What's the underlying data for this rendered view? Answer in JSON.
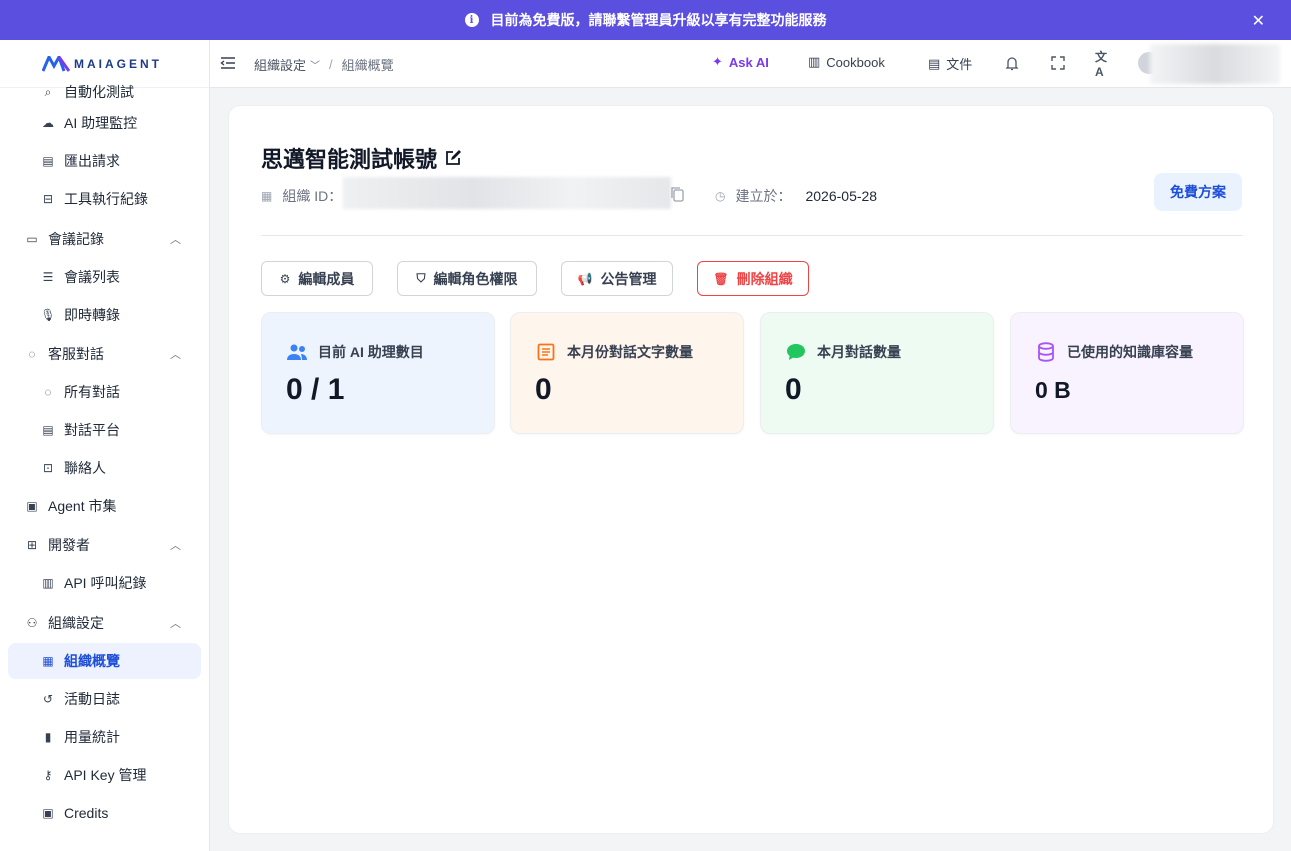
{
  "banner": {
    "text": "目前為免費版，請聯繫管理員升級以享有完整功能服務",
    "close_icon": "close-icon"
  },
  "logo": {
    "word": "MAIAGENT"
  },
  "sidebar": {
    "items": [
      {
        "label": "自動化測試",
        "icon": "search-icon",
        "kind": "sub"
      },
      {
        "label": "AI 助理監控",
        "icon": "cloud-icon",
        "kind": "sub"
      },
      {
        "label": "匯出請求",
        "icon": "file-export-icon",
        "kind": "sub"
      },
      {
        "label": "工具執行紀錄",
        "icon": "toolbox-icon",
        "kind": "sub"
      },
      {
        "label": "會議記錄",
        "icon": "presentation-icon",
        "kind": "group"
      },
      {
        "label": "會議列表",
        "icon": "list-icon",
        "kind": "sub"
      },
      {
        "label": "即時轉錄",
        "icon": "microphone-icon",
        "kind": "sub"
      },
      {
        "label": "客服對話",
        "icon": "chat-icon",
        "kind": "group"
      },
      {
        "label": "所有對話",
        "icon": "chat-dots-icon",
        "kind": "sub"
      },
      {
        "label": "對話平台",
        "icon": "platform-icon",
        "kind": "sub"
      },
      {
        "label": "聯絡人",
        "icon": "contact-card-icon",
        "kind": "sub"
      },
      {
        "label": "Agent 市集",
        "icon": "market-chat-icon",
        "kind": "single"
      },
      {
        "label": "開發者",
        "icon": "developer-icon",
        "kind": "group"
      },
      {
        "label": "API 呼叫紀錄",
        "icon": "document-icon",
        "kind": "sub"
      },
      {
        "label": "組織設定",
        "icon": "team-icon",
        "kind": "group"
      },
      {
        "label": "組織概覽",
        "icon": "grid-icon",
        "kind": "sub"
      },
      {
        "label": "活動日誌",
        "icon": "history-icon",
        "kind": "sub"
      },
      {
        "label": "用量統計",
        "icon": "bar-chart-icon",
        "kind": "sub"
      },
      {
        "label": "API Key 管理",
        "icon": "key-icon",
        "kind": "sub"
      },
      {
        "label": "Credits",
        "icon": "wallet-icon",
        "kind": "sub"
      }
    ],
    "active": "組織概覽"
  },
  "header": {
    "breadcrumb_parent": "組織設定",
    "breadcrumb_sep": "/",
    "breadcrumb_current": "組織概覽",
    "ask_ai": "Ask AI",
    "cookbook": "Cookbook",
    "docs": "文件"
  },
  "org": {
    "name": "思邁智能測試帳號",
    "id_label": "組織 ID：",
    "created_label": "建立於：",
    "created_date": "2026-05-28",
    "plan_button": "免費方案"
  },
  "actions": {
    "edit_members": "編輯成員",
    "edit_roles": "編輯角色權限",
    "announcements": "公告管理",
    "delete_org": "刪除組織"
  },
  "stats": [
    {
      "label": "目前 AI 助理數目",
      "value": "0 / 1",
      "bg": "#edf4fe",
      "icon_color": "#3b82f6"
    },
    {
      "label": "本月份對話文字數量",
      "value": "0",
      "bg": "#fef5ec",
      "icon_color": "#f97316"
    },
    {
      "label": "本月對話數量",
      "value": "0",
      "bg": "#edfbf3",
      "icon_color": "#22c55e"
    },
    {
      "label": "已使用的知識庫容量",
      "value": "0 B",
      "bg": "#f8f3fe",
      "icon_color": "#a855f7"
    }
  ]
}
